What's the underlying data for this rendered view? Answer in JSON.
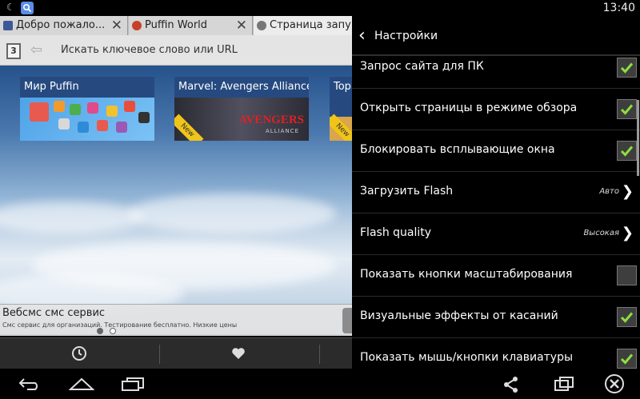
{
  "status_bar": {
    "time": "13:40"
  },
  "browser": {
    "tabs": [
      {
        "title": "Добро пожало..."
      },
      {
        "title": "Puffin World"
      },
      {
        "title": "Страница запу..."
      }
    ],
    "tab_count": "3",
    "url_placeholder": "Искать ключевое слово или URL",
    "tiles": [
      {
        "title": "Мир Puffin"
      },
      {
        "title": "Marvel: Avengers Alliance",
        "badge": "New",
        "logo": "AVENGERS",
        "logo_sub": "ALLIANCE"
      },
      {
        "title": "Top Mar",
        "badge": "New"
      }
    ],
    "ad": {
      "title": "Вебсмс смс сервис",
      "description": "Смс сервис для организаций. Тестирование бесплатно. Низкие цены"
    }
  },
  "settings": {
    "title": "Настройки",
    "items": [
      {
        "label": "Запрос сайта для ПК",
        "type": "checkbox",
        "checked": true
      },
      {
        "label": "Открыть страницы в режиме обзора",
        "type": "checkbox",
        "checked": true
      },
      {
        "label": "Блокировать всплывающие окна",
        "type": "checkbox",
        "checked": true
      },
      {
        "label": "Загрузить Flash",
        "type": "select",
        "value": "Авто"
      },
      {
        "label": "Flash quality",
        "type": "select",
        "value": "Высокая"
      },
      {
        "label": "Показать кнопки масштабирования",
        "type": "checkbox",
        "checked": false
      },
      {
        "label": "Визуальные эффекты от касаний",
        "type": "checkbox",
        "checked": true
      },
      {
        "label": "Показать мышь/кнопки клавиатуры",
        "type": "checkbox",
        "checked": true
      }
    ]
  },
  "icons": {
    "status": [
      "moon-icon",
      "app-icon"
    ],
    "browser_bottom": [
      "clock-icon",
      "heart-icon"
    ],
    "nav": [
      "back-icon",
      "home-icon",
      "recents-icon",
      "share-icon",
      "screen-icon",
      "close-icon"
    ]
  },
  "colors": {
    "check": "#8ce03c",
    "settings_bg": "#000000",
    "tab_bar": "#bdbdbd"
  }
}
